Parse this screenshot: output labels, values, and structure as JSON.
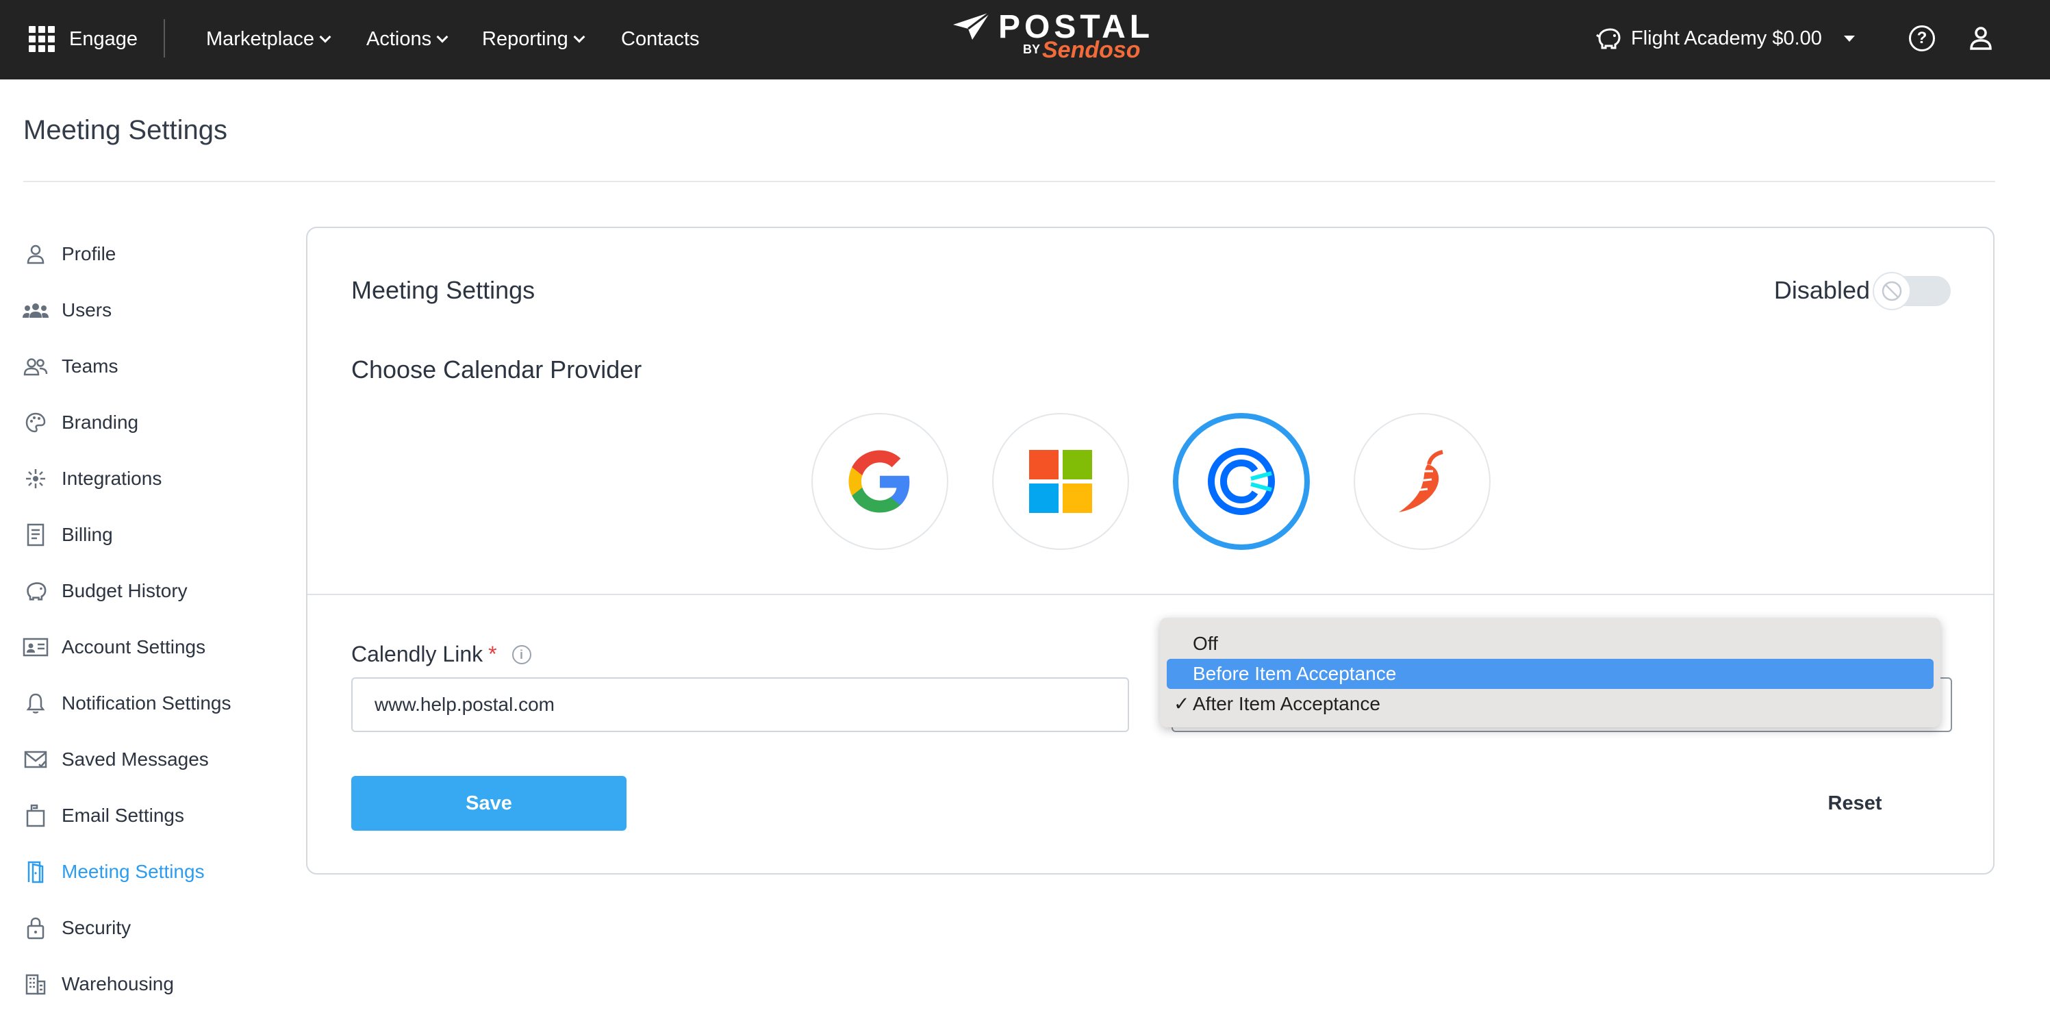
{
  "topbar": {
    "app_name": "Engage",
    "nav": [
      {
        "label": "Marketplace",
        "has_menu": true
      },
      {
        "label": "Actions",
        "has_menu": true
      },
      {
        "label": "Reporting",
        "has_menu": true
      },
      {
        "label": "Contacts",
        "has_menu": false
      }
    ],
    "logo": {
      "word": "POSTAL",
      "by": "BY",
      "brand": "Sendoso"
    },
    "account_label": "Flight Academy $0.00",
    "icons": [
      "grid-icon",
      "piggy-bank-icon",
      "help-icon",
      "user-icon"
    ]
  },
  "page": {
    "title": "Meeting Settings"
  },
  "sidebar": {
    "items": [
      {
        "label": "Profile",
        "icon": "user-icon",
        "active": false
      },
      {
        "label": "Users",
        "icon": "users-icon",
        "active": false
      },
      {
        "label": "Teams",
        "icon": "teams-icon",
        "active": false
      },
      {
        "label": "Branding",
        "icon": "palette-icon",
        "active": false
      },
      {
        "label": "Integrations",
        "icon": "integrations-icon",
        "active": false
      },
      {
        "label": "Billing",
        "icon": "receipt-icon",
        "active": false
      },
      {
        "label": "Budget History",
        "icon": "piggy-bank-icon",
        "active": false
      },
      {
        "label": "Account Settings",
        "icon": "id-card-icon",
        "active": false
      },
      {
        "label": "Notification Settings",
        "icon": "bell-icon",
        "active": false
      },
      {
        "label": "Saved Messages",
        "icon": "envelope-check-icon",
        "active": false
      },
      {
        "label": "Email Settings",
        "icon": "mailbox-icon",
        "active": false
      },
      {
        "label": "Meeting Settings",
        "icon": "door-icon",
        "active": true
      },
      {
        "label": "Security",
        "icon": "lock-icon",
        "active": false
      },
      {
        "label": "Warehousing",
        "icon": "building-icon",
        "active": false
      }
    ]
  },
  "card": {
    "title": "Meeting Settings",
    "status_label": "Disabled",
    "toggle_on": false,
    "provider_heading": "Choose Calendar Provider",
    "providers": [
      {
        "name": "google",
        "icon": "google-icon",
        "selected": false
      },
      {
        "name": "microsoft",
        "icon": "microsoft-icon",
        "selected": false
      },
      {
        "name": "calendly",
        "icon": "calendly-icon",
        "selected": true
      },
      {
        "name": "chili-piper",
        "icon": "chili-pepper-icon",
        "selected": false
      }
    ],
    "link_label": "Calendly Link",
    "required_mark": "*",
    "link_value": "www.help.postal.com",
    "save_label": "Save",
    "reset_label": "Reset"
  },
  "dropdown": {
    "options": [
      {
        "label": "Off",
        "highlighted": false,
        "checked": false
      },
      {
        "label": "Before Item Acceptance",
        "highlighted": true,
        "checked": false
      },
      {
        "label": "After Item Acceptance",
        "highlighted": false,
        "checked": true
      }
    ],
    "check_glyph": "✓"
  },
  "colors": {
    "topbar_bg": "#232323",
    "accent": "#2d9cf0",
    "save_button": "#37a9f2",
    "sendoso_orange": "#f26b3a",
    "dropdown_highlight": "#4a98f0"
  }
}
